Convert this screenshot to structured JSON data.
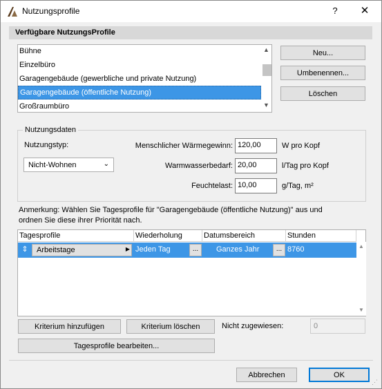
{
  "window": {
    "title": "Nutzungsprofile",
    "help_label": "?",
    "close_label": "✕"
  },
  "profiles_section": {
    "header": "Verfügbare NutzungsProfile",
    "items": [
      {
        "label": "Bühne"
      },
      {
        "label": "Einzelbüro"
      },
      {
        "label": "Garagengebäude (gewerbliche und private Nutzung)"
      },
      {
        "label": "Garagengebäude (öffentliche Nutzung)",
        "selected": true
      },
      {
        "label": "Großraumbüro"
      }
    ],
    "buttons": {
      "new": "Neu...",
      "rename": "Umbenennen...",
      "delete": "Löschen"
    }
  },
  "usage_data": {
    "title": "Nutzungsdaten",
    "type_label": "Nutzungstyp:",
    "type_value": "Nicht-Wohnen",
    "heat_label": "Menschlicher Wärmegewinn:",
    "heat_value": "120,00",
    "heat_unit": "W pro Kopf",
    "water_label": "Warmwasserbedarf:",
    "water_value": "20,00",
    "water_unit": "l/Tag pro Kopf",
    "moisture_label": "Feuchtelast:",
    "moisture_value": "10,00",
    "moisture_unit": "g/Tag, m²"
  },
  "note": {
    "line1": "Anmerkung: Wählen Sie Tagesprofile für \"Garagengebäude (öffentliche Nutzung)\" aus und",
    "line2": "ordnen Sie diese ihrer Priorität nach."
  },
  "schedule_table": {
    "columns": [
      "Tagesprofile",
      "Wiederholung",
      "Datumsbereich",
      "Stunden"
    ],
    "rows": [
      {
        "profile": "Arbeitstage",
        "repeat": "Jeden Tag",
        "range": "Ganzes Jahr",
        "hours": "8760"
      }
    ],
    "dots_label": "..."
  },
  "schedule_actions": {
    "add": "Kriterium hinzufügen",
    "remove": "Kriterium löschen",
    "unassigned_label": "Nicht zugewiesen:",
    "unassigned_value": "0",
    "edit": "Tagesprofile bearbeiten..."
  },
  "footer": {
    "cancel": "Abbrechen",
    "ok": "OK"
  },
  "colors": {
    "selection": "#3d96e6",
    "default_button_border": "#0078d7"
  }
}
